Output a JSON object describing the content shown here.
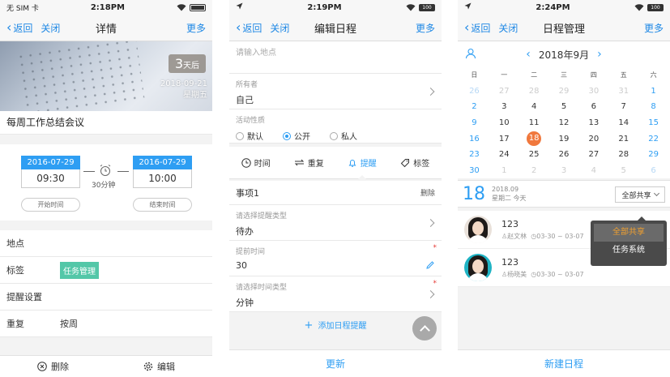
{
  "screen1": {
    "status": {
      "carrier": "无 SIM 卡",
      "time": "2:18PM"
    },
    "nav": {
      "back": "返回",
      "close": "关闭",
      "title": "详情",
      "more": "更多"
    },
    "banner": {
      "count": "3",
      "count_unit": "天后",
      "date": "2018-09-21",
      "weekday": "星期五"
    },
    "meeting_title": "每周工作总结会议",
    "start": {
      "date": "2016-07-29",
      "time": "09:30",
      "label": "开始时间"
    },
    "end": {
      "date": "2016-07-29",
      "time": "10:00",
      "label": "结束时间"
    },
    "duration": "30分钟",
    "rows": [
      {
        "label": "地点",
        "value": ""
      },
      {
        "label": "标签",
        "value": "任务管理"
      },
      {
        "label": "提醒设置",
        "value": ""
      },
      {
        "label": "重复",
        "value": "按周"
      }
    ],
    "bottom": {
      "delete": "删除",
      "edit": "编辑"
    }
  },
  "screen2": {
    "status": {
      "time": "2:19PM",
      "battery": "100"
    },
    "nav": {
      "back": "返回",
      "close": "关闭",
      "title": "编辑日程",
      "more": "更多"
    },
    "location_placeholder": "请输入地点",
    "owner": {
      "label": "所有者",
      "value": "自己"
    },
    "activity": {
      "label": "活动性质",
      "options": [
        "默认",
        "公开",
        "私人"
      ],
      "selected": 1
    },
    "tabs": [
      {
        "label": "时间",
        "icon": "clock-icon"
      },
      {
        "label": "重复",
        "icon": "repeat-icon"
      },
      {
        "label": "提醒",
        "icon": "bell-icon",
        "active": true
      },
      {
        "label": "标签",
        "icon": "tag-icon"
      }
    ],
    "item": {
      "title": "事项1",
      "delete": "删除"
    },
    "fields": [
      {
        "label": "请选择提醒类型",
        "value": "待办"
      },
      {
        "label": "提前时间",
        "value": "30"
      },
      {
        "label": "请选择时间类型",
        "value": "分钟"
      }
    ],
    "add_reminder": "添加日程提醒",
    "bottom_button": "更新"
  },
  "screen3": {
    "status": {
      "time": "2:24PM",
      "battery": "100"
    },
    "nav": {
      "back": "返回",
      "close": "关闭",
      "title": "日程管理",
      "more": "更多"
    },
    "month": "2018年9月",
    "weekdays": [
      "日",
      "一",
      "二",
      "三",
      "四",
      "五",
      "六"
    ],
    "weeks": [
      [
        "26",
        "27",
        "28",
        "29",
        "30",
        "31",
        "1"
      ],
      [
        "2",
        "3",
        "4",
        "5",
        "6",
        "7",
        "8"
      ],
      [
        "9",
        "10",
        "11",
        "12",
        "13",
        "14",
        "15"
      ],
      [
        "16",
        "17",
        "18",
        "19",
        "20",
        "21",
        "22"
      ],
      [
        "23",
        "24",
        "25",
        "26",
        "27",
        "28",
        "29"
      ],
      [
        "30",
        "1",
        "2",
        "3",
        "4",
        "5",
        "6"
      ]
    ],
    "today": "18",
    "summary": {
      "day": "18",
      "year_month": "2018.09",
      "weekday": "星期二 今天"
    },
    "share_select": "全部共享",
    "dropdown": [
      "全部共享",
      "任务系统"
    ],
    "events": [
      {
        "title": "123",
        "person": "赵文林",
        "range": "03-30 ~ 03-07",
        "avatar": "light"
      },
      {
        "title": "123",
        "person": "杨晓美",
        "range": "03-30 ~ 03-07",
        "avatar": "teal"
      }
    ],
    "bottom_button": "新建日程"
  },
  "colors": {
    "accent": "#2e9ef3",
    "today": "#f0783d",
    "tag": "#53c7a8"
  }
}
